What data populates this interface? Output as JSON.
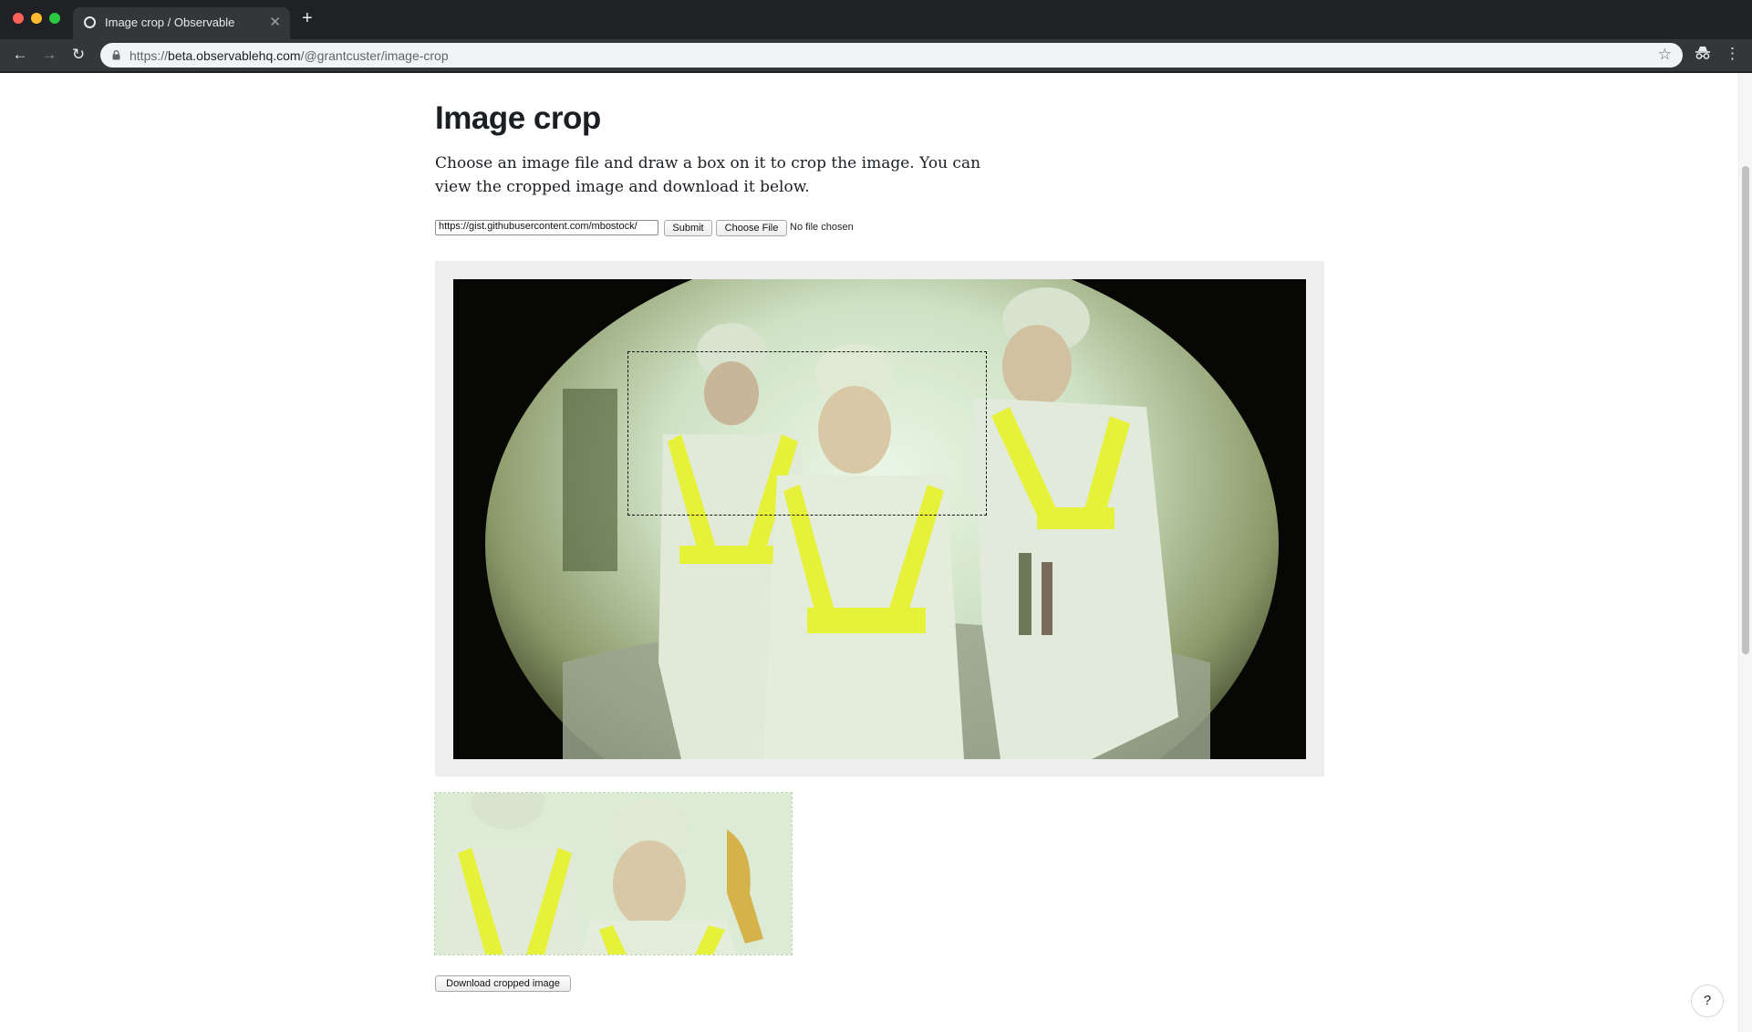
{
  "browser": {
    "tab_title": "Image crop / Observable",
    "new_tab_icon": "+",
    "url_scheme": "https://",
    "url_host": "beta.observablehq.com",
    "url_path": "/@grantcuster/image-crop"
  },
  "page": {
    "title": "Image crop",
    "intro": "Choose an image file and draw a box on it to crop the image. You can view the cropped image and download it below.",
    "url_input_value": "https://gist.githubusercontent.com/mbostock/",
    "submit_label": "Submit",
    "choose_file_label": "Choose File",
    "no_file_text": "No file chosen",
    "download_label": "Download cropped image",
    "help_label": "?"
  },
  "colors": {
    "chrome_dark": "#202124",
    "chrome_toolbar": "#35363a",
    "frame_bg": "#eeeeee",
    "vest_yellow": "#e6f23a"
  }
}
